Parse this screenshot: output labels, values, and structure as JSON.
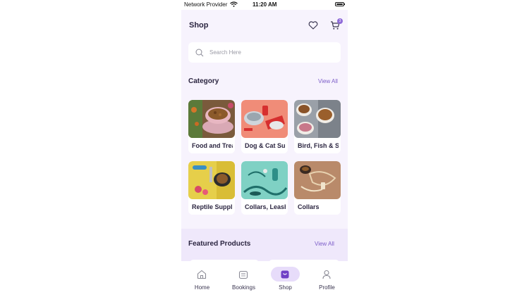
{
  "statusbar": {
    "carrier": "Network Provider",
    "time": "11:20 AM"
  },
  "header": {
    "title": "Shop",
    "cart_count": "3",
    "icons": [
      "heart-icon",
      "cart-icon"
    ]
  },
  "search": {
    "placeholder": "Search Here",
    "value": ""
  },
  "category": {
    "title": "Category",
    "view_all": "View All",
    "items": [
      {
        "label": "Food and Treats",
        "image": "dog-food-bowl"
      },
      {
        "label": "Dog & Cat Supplies",
        "image": "pet-bowls-red"
      },
      {
        "label": "Bird, Fish & Small Pets",
        "image": "food-bowls-gray"
      },
      {
        "label": "Reptile Supplies",
        "image": "toys-yellow"
      },
      {
        "label": "Collars, Leashes",
        "image": "leashes-teal"
      },
      {
        "label": "Collars",
        "image": "collars-brown"
      }
    ]
  },
  "featured": {
    "title": "Featured Products",
    "view_all": "View All"
  },
  "nav": {
    "items": [
      {
        "label": "Home",
        "icon": "home-icon"
      },
      {
        "label": "Bookings",
        "icon": "calendar-icon"
      },
      {
        "label": "Shop",
        "icon": "shop-bag-icon",
        "active": true
      },
      {
        "label": "Profile",
        "icon": "profile-icon"
      }
    ]
  },
  "colors": {
    "accent": "#7b5cc8",
    "background": "#f7f3fd",
    "active_pill": "#e7dcfa"
  }
}
